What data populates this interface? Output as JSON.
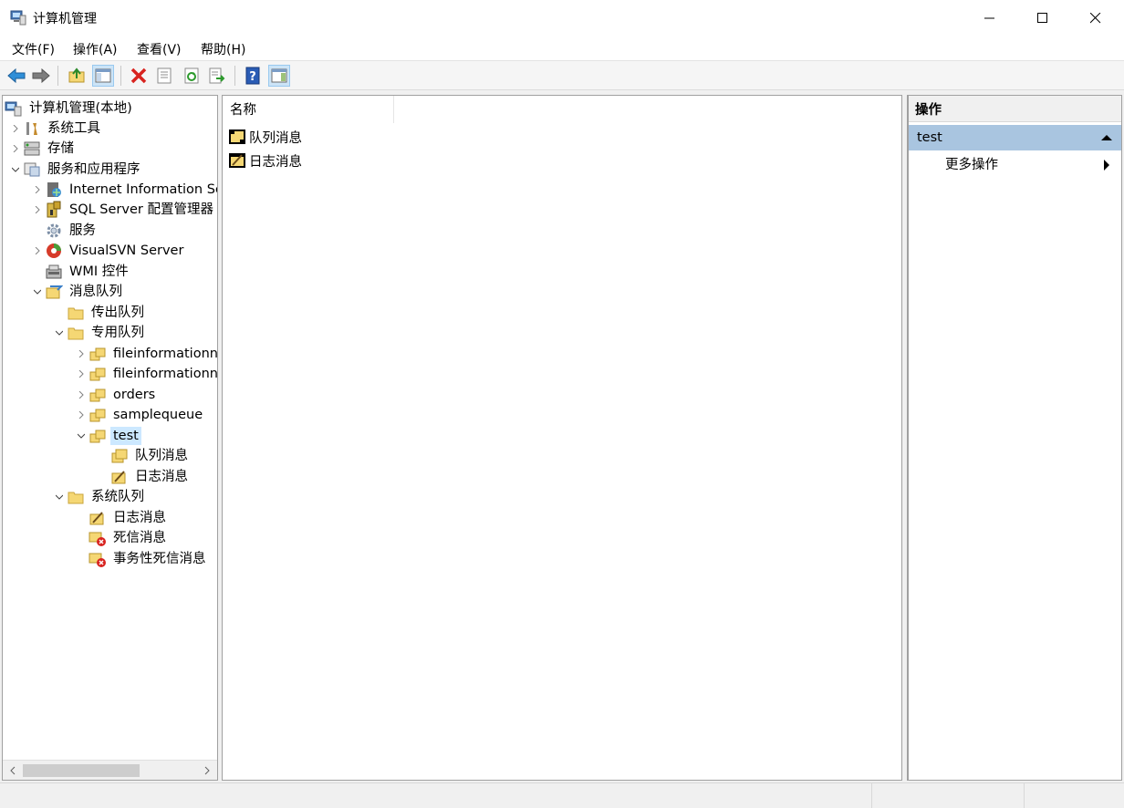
{
  "window": {
    "title": "计算机管理",
    "icon": "computer-management-icon"
  },
  "menu": [
    "文件(F)",
    "操作(A)",
    "查看(V)",
    "帮助(H)"
  ],
  "toolbar": {
    "buttons": [
      "back-icon",
      "forward-icon",
      "up-folder-icon",
      "show-hide-tree-icon",
      "delete-icon",
      "properties-icon",
      "refresh-icon",
      "export-icon",
      "help-icon",
      "show-hide-action-icon"
    ]
  },
  "tree": {
    "root": "计算机管理(本地)",
    "system_tools": "系统工具",
    "storage": "存储",
    "services_apps": "服务和应用程序",
    "iis": "Internet Information Se",
    "sql_server": "SQL Server 配置管理器",
    "services": "服务",
    "visualsvn": "VisualSVN Server",
    "wmi": "WMI 控件",
    "msmq": "消息队列",
    "outgoing": "传出队列",
    "private": "专用队列",
    "fileinfo1": "fileinformationn",
    "fileinfo2": "fileinformationn",
    "orders": "orders",
    "samplequeue": "samplequeue",
    "test": "test",
    "test_queue_msgs": "队列消息",
    "test_journal_msgs": "日志消息",
    "system_queues": "系统队列",
    "sys_journal": "日志消息",
    "sys_dead": "死信消息",
    "sys_tx_dead": "事务性死信消息"
  },
  "list": {
    "column_name": "名称",
    "items": [
      "队列消息",
      "日志消息"
    ]
  },
  "actions": {
    "header": "操作",
    "section": "test",
    "more": "更多操作"
  },
  "colors": {
    "selection": "#cce8ff",
    "action_section": "#a9c5e0",
    "folder": "#f5d774"
  }
}
